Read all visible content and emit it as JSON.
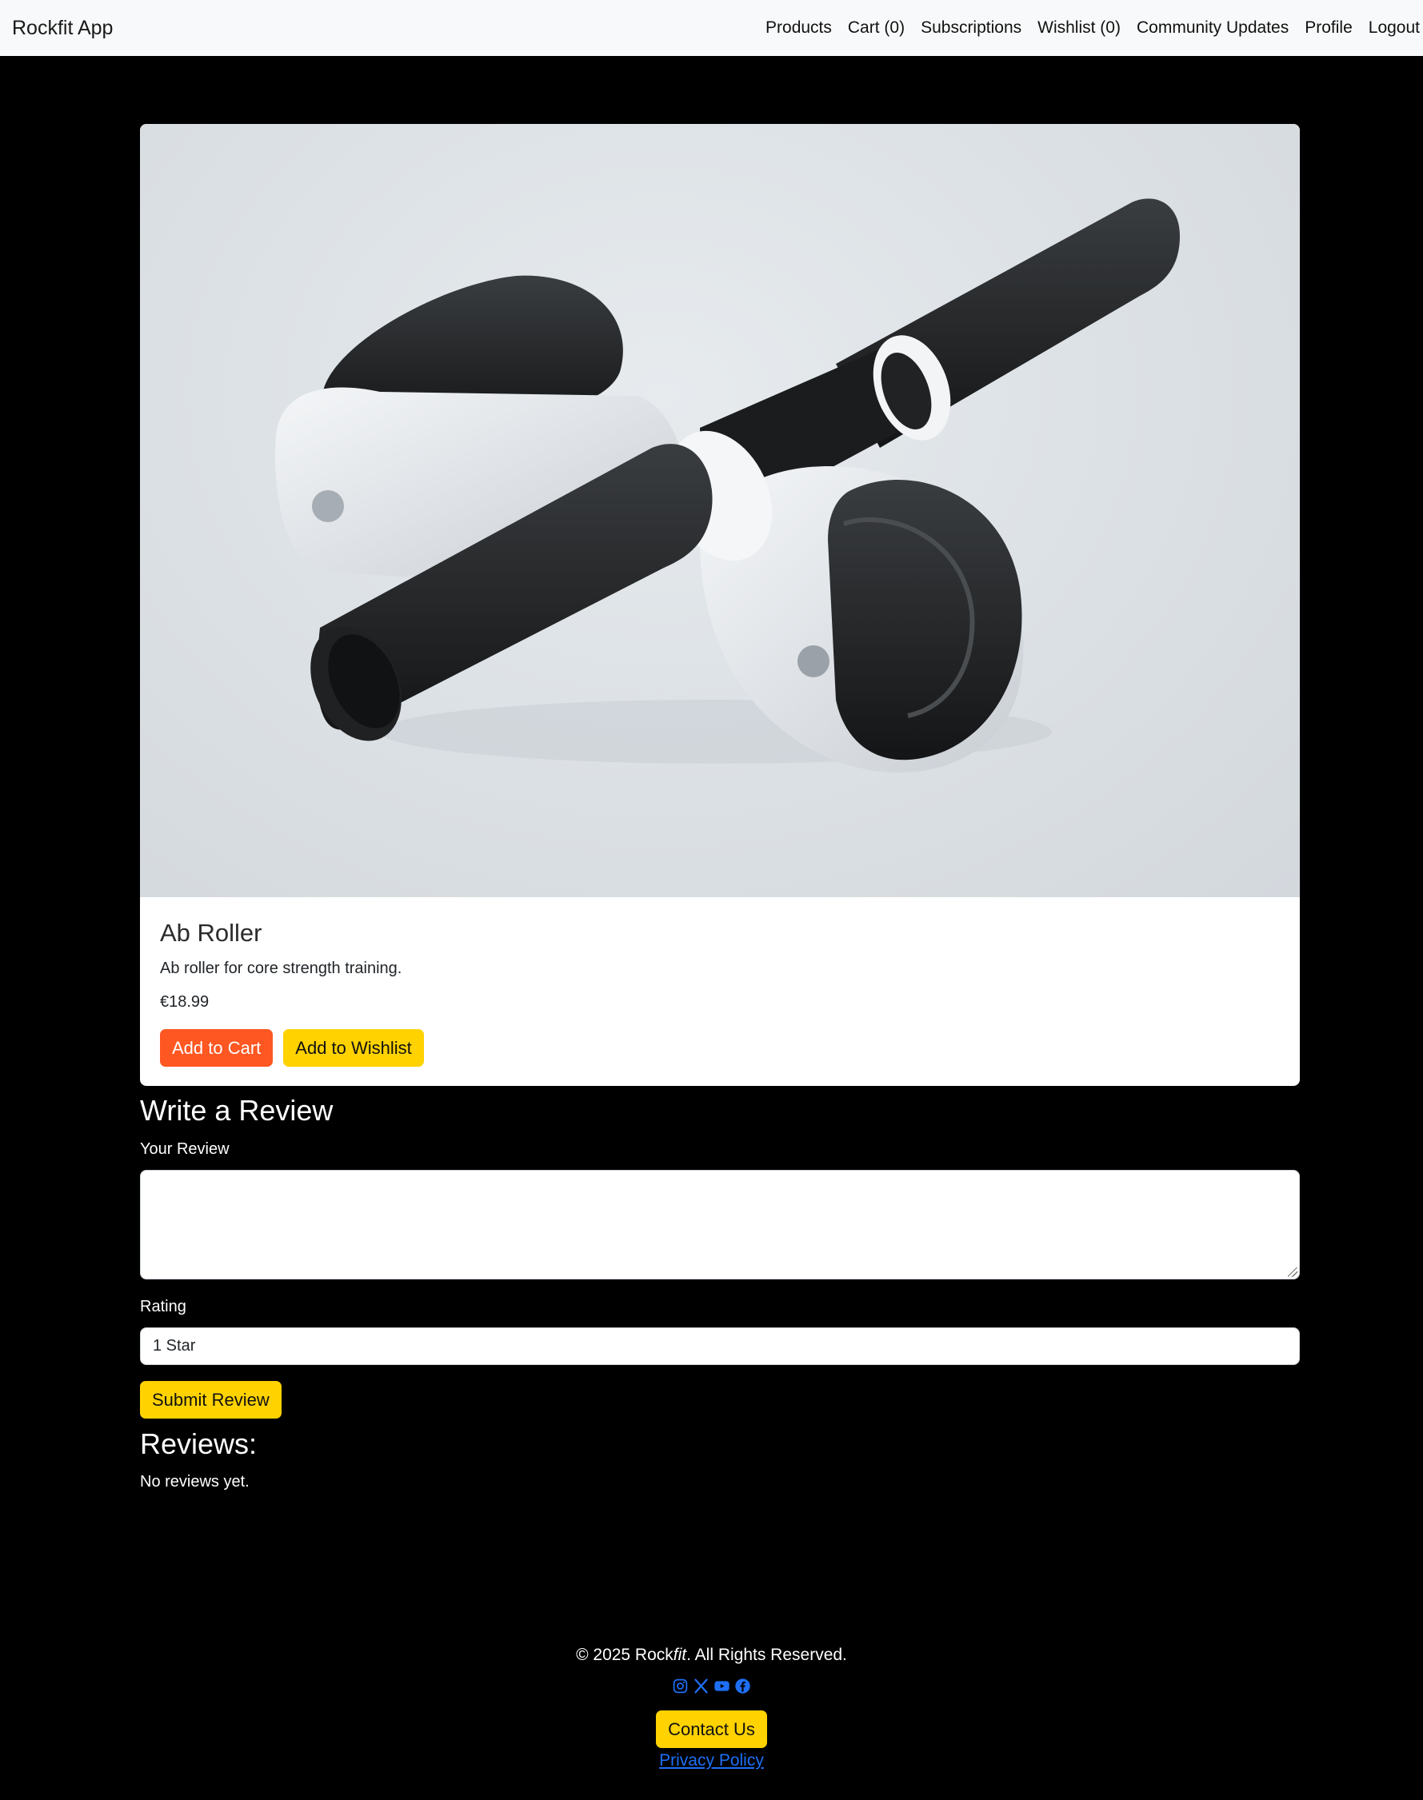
{
  "nav": {
    "brand": "Rockfit App",
    "links": [
      "Products",
      "Cart (0)",
      "Subscriptions",
      "Wishlist (0)",
      "Community Updates",
      "Profile",
      "Logout"
    ]
  },
  "product": {
    "image_alt": "Ab roller product photo",
    "title": "Ab Roller",
    "description": "Ab roller for core strength training.",
    "price": "€18.99",
    "add_to_cart": "Add to Cart",
    "add_to_wishlist": "Add to Wishlist"
  },
  "review_form": {
    "heading": "Write a Review",
    "review_label": "Your Review",
    "review_value": "",
    "rating_label": "Rating",
    "rating_selected": "1 Star",
    "submit": "Submit Review"
  },
  "reviews": {
    "heading": "Reviews:",
    "empty_text": "No reviews yet."
  },
  "footer": {
    "copyright_prefix": "© 2025 Rock",
    "copyright_brand_italic": "fit",
    "copyright_suffix": ". All Rights Reserved.",
    "social_icons": [
      "instagram-icon",
      "x-icon",
      "youtube-icon",
      "facebook-icon"
    ],
    "contact": "Contact Us",
    "privacy": "Privacy Policy"
  },
  "colors": {
    "page_bg": "#000000",
    "navbar_bg": "#f8f9fa",
    "cart_button": "#fe5722",
    "accent_yellow": "#ffd200",
    "link_blue": "#1e6ff5"
  }
}
